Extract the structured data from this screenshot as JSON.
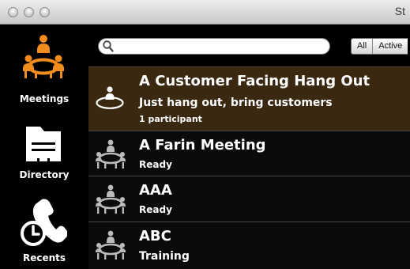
{
  "window": {
    "title": "St"
  },
  "colors": {
    "accent": "#f28c1c",
    "selected_row_bg": "#3b2810",
    "row_bg": "#0b0b0b"
  },
  "sidebar": {
    "items": [
      {
        "label": "Meetings",
        "icon": "meetings-icon",
        "active": true
      },
      {
        "label": "Directory",
        "icon": "directory-icon",
        "active": false
      },
      {
        "label": "Recents",
        "icon": "recents-icon",
        "active": false
      }
    ]
  },
  "search": {
    "value": "",
    "placeholder": ""
  },
  "filters": {
    "all_label": "All",
    "active_label": "Active"
  },
  "meetings": [
    {
      "title": "A Customer Facing Hang Out",
      "subtitle": "Just hang out, bring customers",
      "meta": "1 participant",
      "selected": true,
      "icon": "meeting-room-icon"
    },
    {
      "title": "A Farin Meeting",
      "subtitle": "Ready",
      "meta": "",
      "selected": false,
      "icon": "meeting-room-icon"
    },
    {
      "title": "AAA",
      "subtitle": "Ready",
      "meta": "",
      "selected": false,
      "icon": "meeting-room-icon"
    },
    {
      "title": "ABC",
      "subtitle": "Training",
      "meta": "",
      "selected": false,
      "icon": "meeting-room-icon"
    }
  ]
}
